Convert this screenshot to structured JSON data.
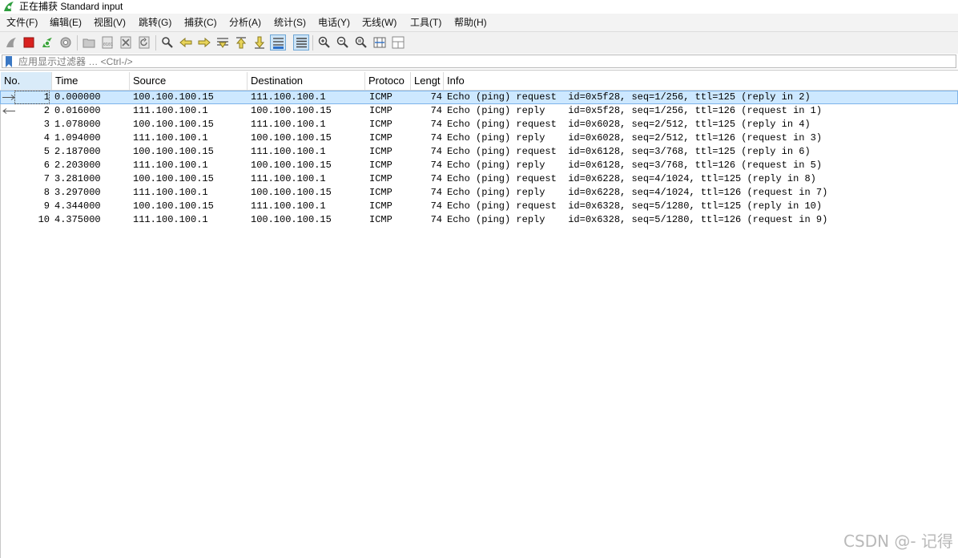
{
  "window": {
    "title": "正在捕获 Standard input",
    "app_icon": "wireshark-shark-fin-icon"
  },
  "menu": [
    "文件(F)",
    "编辑(E)",
    "视图(V)",
    "跳转(G)",
    "捕获(C)",
    "分析(A)",
    "统计(S)",
    "电话(Y)",
    "无线(W)",
    "工具(T)",
    "帮助(H)"
  ],
  "toolbar": {
    "buttons": [
      "start-capture-icon",
      "stop-capture-icon",
      "restart-capture-icon",
      "capture-options-icon",
      "open-file-icon",
      "save-file-icon",
      "close-file-icon",
      "reload-file-icon",
      "find-packet-icon",
      "go-back-icon",
      "go-forward-icon",
      "go-to-packet-icon",
      "first-packet-icon",
      "last-packet-icon",
      "auto-scroll-icon",
      "colorize-icon",
      "zoom-in-icon",
      "zoom-out-icon",
      "normal-size-icon",
      "resize-columns-icon",
      "layout-icon"
    ],
    "checked": [
      "auto-scroll-icon",
      "colorize-icon"
    ]
  },
  "filter": {
    "placeholder": "应用显示过滤器 … <Ctrl-/>",
    "value": ""
  },
  "columns": [
    "No.",
    "Time",
    "Source",
    "Destination",
    "Protoco",
    "Lengt",
    "Info"
  ],
  "packets": [
    {
      "no": "1",
      "time": "0.000000",
      "src": "100.100.100.15",
      "dst": "111.100.100.1",
      "proto": "ICMP",
      "len": "74",
      "info": "Echo (ping) request  id=0x5f28, seq=1/256, ttl=125 (reply in 2)",
      "related": "request"
    },
    {
      "no": "2",
      "time": "0.016000",
      "src": "111.100.100.1",
      "dst": "100.100.100.15",
      "proto": "ICMP",
      "len": "74",
      "info": "Echo (ping) reply    id=0x5f28, seq=1/256, ttl=126 (request in 1)",
      "related": "reply"
    },
    {
      "no": "3",
      "time": "1.078000",
      "src": "100.100.100.15",
      "dst": "111.100.100.1",
      "proto": "ICMP",
      "len": "74",
      "info": "Echo (ping) request  id=0x6028, seq=2/512, ttl=125 (reply in 4)",
      "related": ""
    },
    {
      "no": "4",
      "time": "1.094000",
      "src": "111.100.100.1",
      "dst": "100.100.100.15",
      "proto": "ICMP",
      "len": "74",
      "info": "Echo (ping) reply    id=0x6028, seq=2/512, ttl=126 (request in 3)",
      "related": ""
    },
    {
      "no": "5",
      "time": "2.187000",
      "src": "100.100.100.15",
      "dst": "111.100.100.1",
      "proto": "ICMP",
      "len": "74",
      "info": "Echo (ping) request  id=0x6128, seq=3/768, ttl=125 (reply in 6)",
      "related": ""
    },
    {
      "no": "6",
      "time": "2.203000",
      "src": "111.100.100.1",
      "dst": "100.100.100.15",
      "proto": "ICMP",
      "len": "74",
      "info": "Echo (ping) reply    id=0x6128, seq=3/768, ttl=126 (request in 5)",
      "related": ""
    },
    {
      "no": "7",
      "time": "3.281000",
      "src": "100.100.100.15",
      "dst": "111.100.100.1",
      "proto": "ICMP",
      "len": "74",
      "info": "Echo (ping) request  id=0x6228, seq=4/1024, ttl=125 (reply in 8)",
      "related": ""
    },
    {
      "no": "8",
      "time": "3.297000",
      "src": "111.100.100.1",
      "dst": "100.100.100.15",
      "proto": "ICMP",
      "len": "74",
      "info": "Echo (ping) reply    id=0x6228, seq=4/1024, ttl=126 (request in 7)",
      "related": ""
    },
    {
      "no": "9",
      "time": "4.344000",
      "src": "100.100.100.15",
      "dst": "111.100.100.1",
      "proto": "ICMP",
      "len": "74",
      "info": "Echo (ping) request  id=0x6328, seq=5/1280, ttl=125 (reply in 10)",
      "related": ""
    },
    {
      "no": "10",
      "time": "4.375000",
      "src": "111.100.100.1",
      "dst": "100.100.100.15",
      "proto": "ICMP",
      "len": "74",
      "info": "Echo (ping) reply    id=0x6328, seq=5/1280, ttl=126 (request in 9)",
      "related": ""
    }
  ],
  "selected_packet": "1",
  "watermark": "CSDN @- 记得",
  "colors": {
    "selected_row": "#cde8ff",
    "sorted_header": "#d9ebf9",
    "stop_red": "#d9211f",
    "start_green": "#3aa33a"
  }
}
